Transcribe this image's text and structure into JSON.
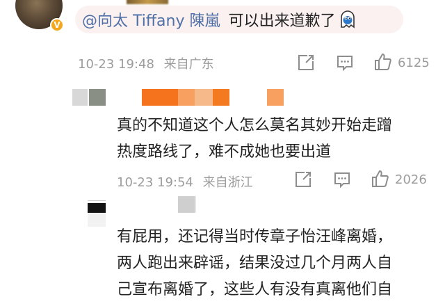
{
  "comments": [
    {
      "mention": "@向太 Tiffany 陳嵐",
      "text": "可以出来道歉了",
      "emoji": "ghost-emoji",
      "time": "10-23 19:48",
      "location": "来自广东",
      "likes": "6125"
    },
    {
      "text_line1": "真的不知道这个人怎么莫名其妙开始走蹭",
      "text_line2": "热度路线了，难不成她也要出道",
      "time": "10-23 19:54",
      "location": "来自浙江",
      "likes": "2026"
    },
    {
      "text_line1": "有屁用，还记得当时传章子怡汪峰离婚，",
      "text_line2": "两人跑出来辟谣，结果没过几个月两人自",
      "text_line3": "己宣布离婚了，这些人有没有真离他们自"
    }
  ],
  "icons": {
    "share": "share-icon",
    "comment": "comment-icon",
    "like": "thumbs-up-icon",
    "verified": "verified-badge-icon"
  },
  "colors": {
    "mention": "#4f6fa5",
    "meta": "#9c9c9c",
    "bubble_bg": "#fbf1f1",
    "verified_badge": "#f4a71d"
  }
}
